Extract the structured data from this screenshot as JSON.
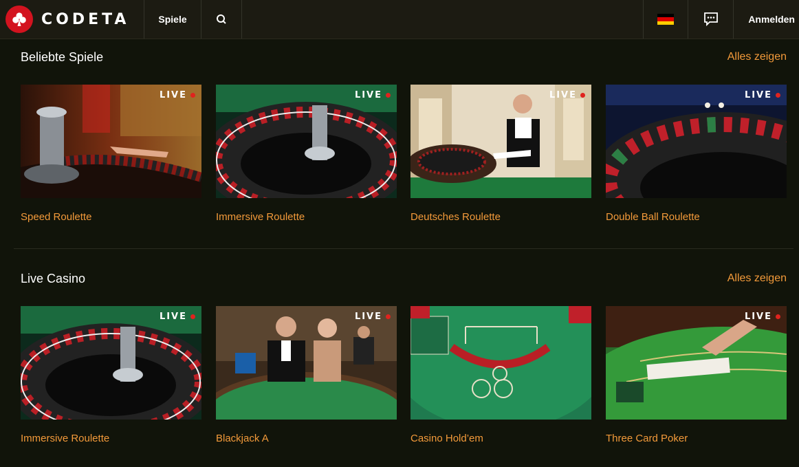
{
  "header": {
    "logo_text": "CODETA",
    "nav_games": "Spiele",
    "login": "Anmelden"
  },
  "sections": [
    {
      "title": "Beliebte Spiele",
      "see_all": "Alles zeigen",
      "games": [
        {
          "title": "Speed Roulette",
          "badge": "LIVE"
        },
        {
          "title": "Immersive Roulette",
          "badge": "LIVE"
        },
        {
          "title": "Deutsches Roulette",
          "badge": "LIVE"
        },
        {
          "title": "Double Ball Roulette",
          "badge": "LIVE"
        }
      ]
    },
    {
      "title": "Live Casino",
      "see_all": "Alles zeigen",
      "games": [
        {
          "title": "Immersive Roulette",
          "badge": "LIVE"
        },
        {
          "title": "Blackjack A",
          "badge": "LIVE"
        },
        {
          "title": "Casino Hold’em",
          "badge": ""
        },
        {
          "title": "Three Card Poker",
          "badge": "LIVE"
        }
      ]
    }
  ],
  "colors": {
    "accent": "#f39a3a",
    "brand_red": "#d3131f",
    "background": "#11140a",
    "header": "#1c1b12"
  }
}
